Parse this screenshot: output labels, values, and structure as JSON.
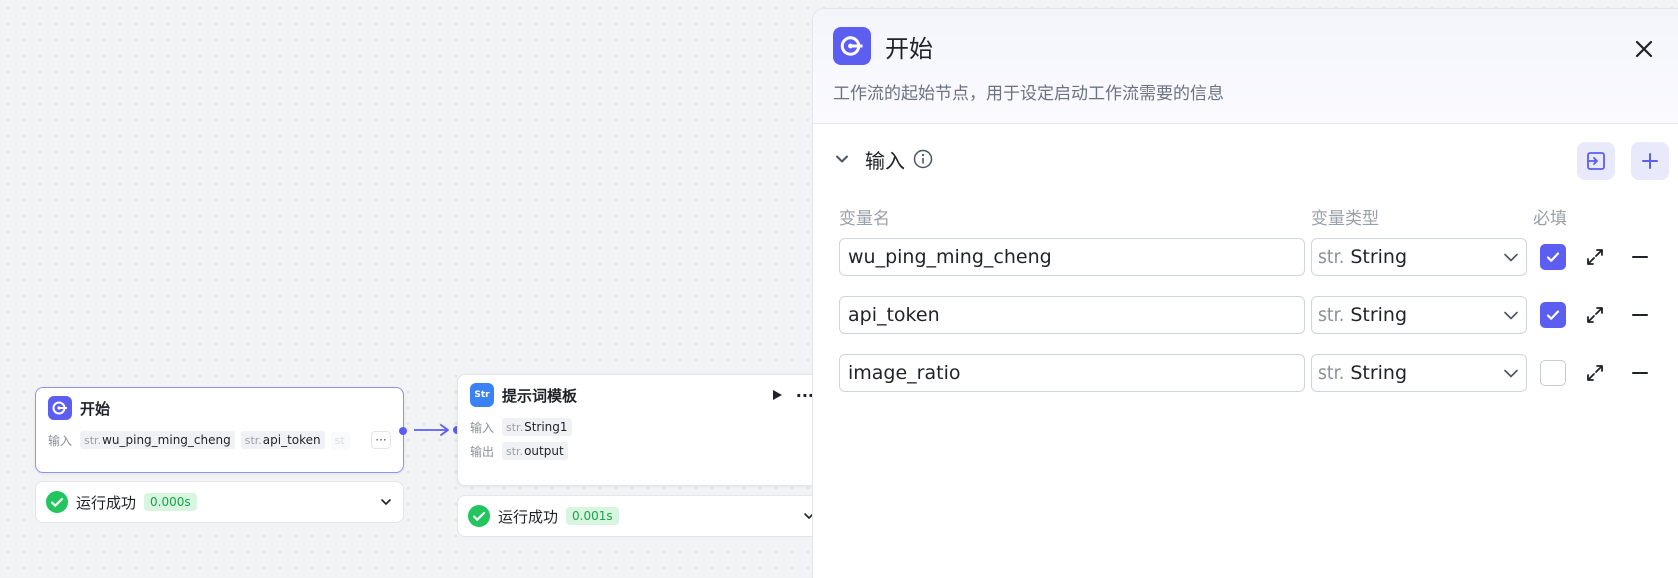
{
  "canvas": {
    "start_node": {
      "title": "开始",
      "input_label": "输入",
      "inputs": [
        {
          "type": "str.",
          "name": "wu_ping_ming_cheng"
        },
        {
          "type": "str.",
          "name": "api_token"
        },
        {
          "type": "st",
          "name": ""
        }
      ],
      "more": "···",
      "status": "运行成功",
      "time": "0.000s"
    },
    "prompt_node": {
      "title": "提示词模板",
      "icon_label": "Str",
      "input_label": "输入",
      "output_label": "输出",
      "input": {
        "type": "str.",
        "name": "String1"
      },
      "output": {
        "type": "str.",
        "name": "output"
      },
      "more": "···",
      "status": "运行成功",
      "time": "0.001s"
    }
  },
  "panel": {
    "title": "开始",
    "description": "工作流的起始节点，用于设定启动工作流需要的信息",
    "section": {
      "title": "输入",
      "columns": {
        "name": "变量名",
        "type": "变量类型",
        "required": "必填"
      },
      "rows": [
        {
          "name": "wu_ping_ming_cheng",
          "type_prefix": "str.",
          "type": "String",
          "required": true
        },
        {
          "name": "api_token",
          "type_prefix": "str.",
          "type": "String",
          "required": true
        },
        {
          "name": "image_ratio",
          "type_prefix": "str.",
          "type": "String",
          "required": false
        }
      ]
    }
  },
  "colors": {
    "accent": "#5b5ef0",
    "success": "#22c55e",
    "success_bg": "#d8f5df"
  }
}
